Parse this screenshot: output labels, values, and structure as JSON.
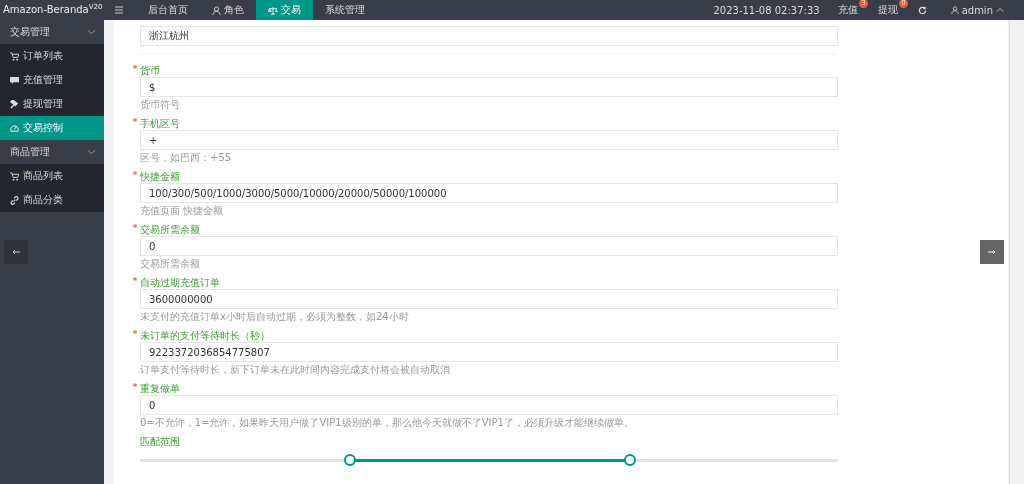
{
  "brand": {
    "name": "Amazon-Beranda",
    "version": "V20"
  },
  "top_nav": [
    {
      "label": "后台首页",
      "selected": false
    },
    {
      "label": "角色",
      "selected": false
    },
    {
      "label": "交易",
      "selected": true
    },
    {
      "label": "系统管理",
      "selected": false
    }
  ],
  "clock": {
    "value": "2023-11-08 02:37:33"
  },
  "top_actions": [
    {
      "label": "充值",
      "badge": "3"
    },
    {
      "label": "提现",
      "badge": "0"
    }
  ],
  "user": {
    "name": "admin"
  },
  "sidebar": [
    {
      "label": "交易管理",
      "expanded": true,
      "children": [
        {
          "label": "订单列表",
          "selected": false
        },
        {
          "label": "充值管理",
          "selected": false
        },
        {
          "label": "提现管理",
          "selected": false
        },
        {
          "label": "交易控制",
          "selected": true
        }
      ]
    },
    {
      "label": "商品管理",
      "expanded": true,
      "children": [
        {
          "label": "商品列表",
          "selected": false
        },
        {
          "label": "商品分类",
          "selected": false
        }
      ]
    }
  ],
  "form": {
    "fields": [
      {
        "kind": "text",
        "value": "浙江杭州"
      },
      {
        "kind": "text",
        "required": true,
        "label": "货币",
        "value": "$",
        "help": "货币符号"
      },
      {
        "kind": "text",
        "required": true,
        "label": "手机区号",
        "value": "+",
        "help": "区号，如巴西：+55"
      },
      {
        "kind": "text",
        "required": true,
        "label": "快捷金额",
        "value": "100/300/500/1000/3000/5000/10000/20000/50000/100000",
        "help": "充值页面 快捷金额"
      },
      {
        "kind": "text",
        "required": true,
        "label": "交易所需余额",
        "value": "0",
        "help": "交易所需余额"
      },
      {
        "kind": "text",
        "required": true,
        "label": "自动过期充值订单",
        "value": "3600000000",
        "help": "未支付的充值订单x小时后自动过期，必须为整数，如24小时"
      },
      {
        "kind": "text",
        "required": true,
        "label": "未订单的支付等待时长（秒）",
        "value": "9223372036854775807",
        "help": "订单支付等待时长，新下订单未在此时间内容完成支付将会被自动取消"
      },
      {
        "kind": "text",
        "required": true,
        "label": "重复做单",
        "value": "0",
        "help": "0=不允许，1=允许，如果昨天用户做了VIP1级别的单，那么他今天就做不了VIP1了，必须升级才能继续做单。"
      },
      {
        "kind": "range",
        "label": "匹配范围",
        "thumbs": [
          {
            "level": 0.3
          },
          {
            "level": 0.7
          }
        ]
      }
    ]
  }
}
